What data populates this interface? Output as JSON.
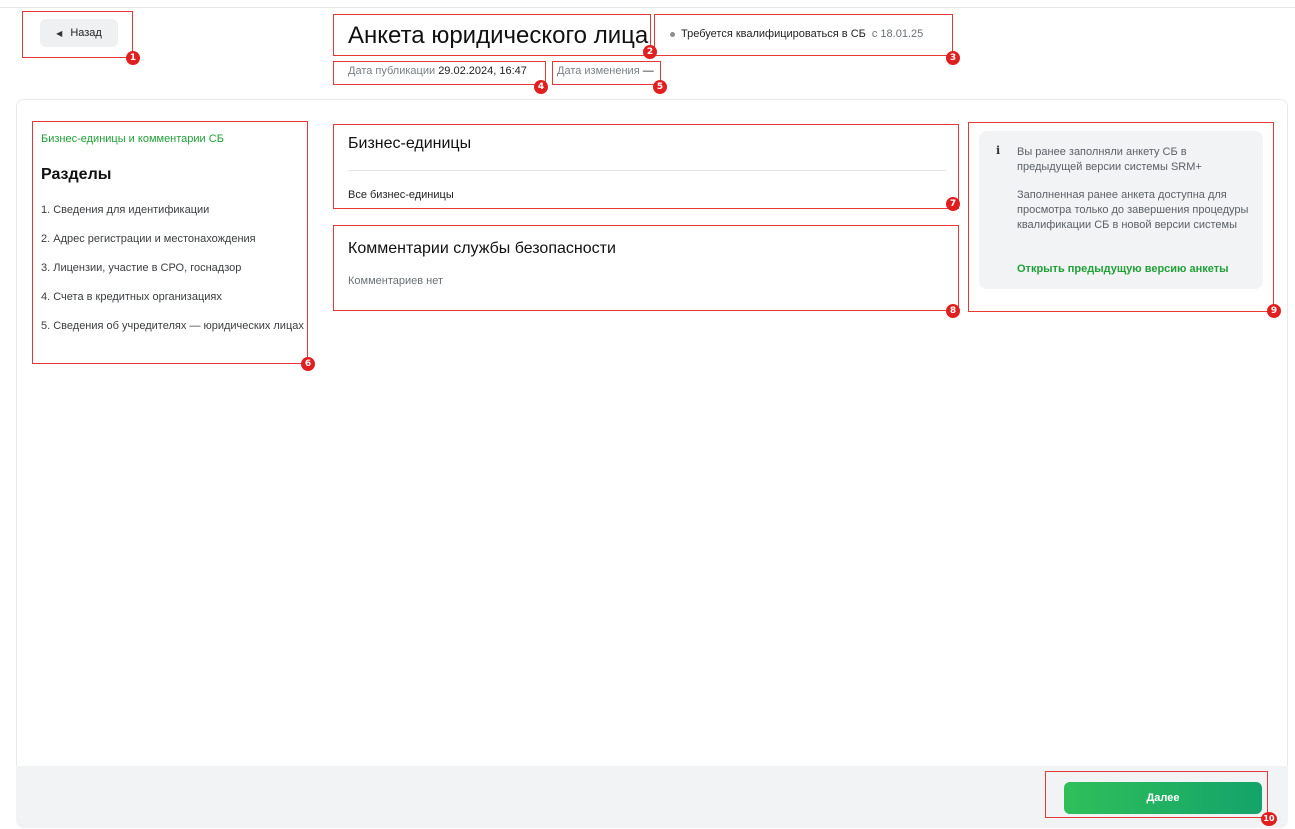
{
  "header": {
    "back_label": "Назад",
    "title": "Анкета юридического лица",
    "status": "Требуется квалифицироваться в СБ",
    "status_since": "с 18.01.25",
    "published_label": "Дата публикации",
    "published_value": "29.02.2024, 16:47",
    "modified_label": "Дата изменения",
    "modified_value": "—"
  },
  "sidebar": {
    "active_link": "Бизнес-единицы и комментарии СБ",
    "heading": "Разделы",
    "items": [
      "1.  Сведения для идентификации",
      "2.  Адрес регистрации и местонахождения",
      "3.  Лицензии, участие в СРО, госнадзор",
      "4.  Счета в кредитных организациях",
      "5.  Сведения об учредителях — юридических лицах"
    ]
  },
  "business_units": {
    "title": "Бизнес-единицы",
    "value": "Все бизнес-единицы"
  },
  "security_comments": {
    "title": "Комментарии службы безопасности",
    "value": "Комментариев нет"
  },
  "info_panel": {
    "icon": "i",
    "text1": "Вы ранее заполняли анкету СБ в предыдущей версии системы SRM+",
    "text2": "Заполненная ранее анкета доступна для просмотра только до завершения процедуры квалификации СБ в новой версии системы",
    "link": "Открыть предыдущую версию анкеты"
  },
  "footer": {
    "next_label": "Далее"
  },
  "markers": [
    "1",
    "2",
    "3",
    "4",
    "5",
    "6",
    "7",
    "8",
    "9",
    "10"
  ],
  "colors": {
    "accent": "#21a038",
    "annotation": "#e53935"
  }
}
